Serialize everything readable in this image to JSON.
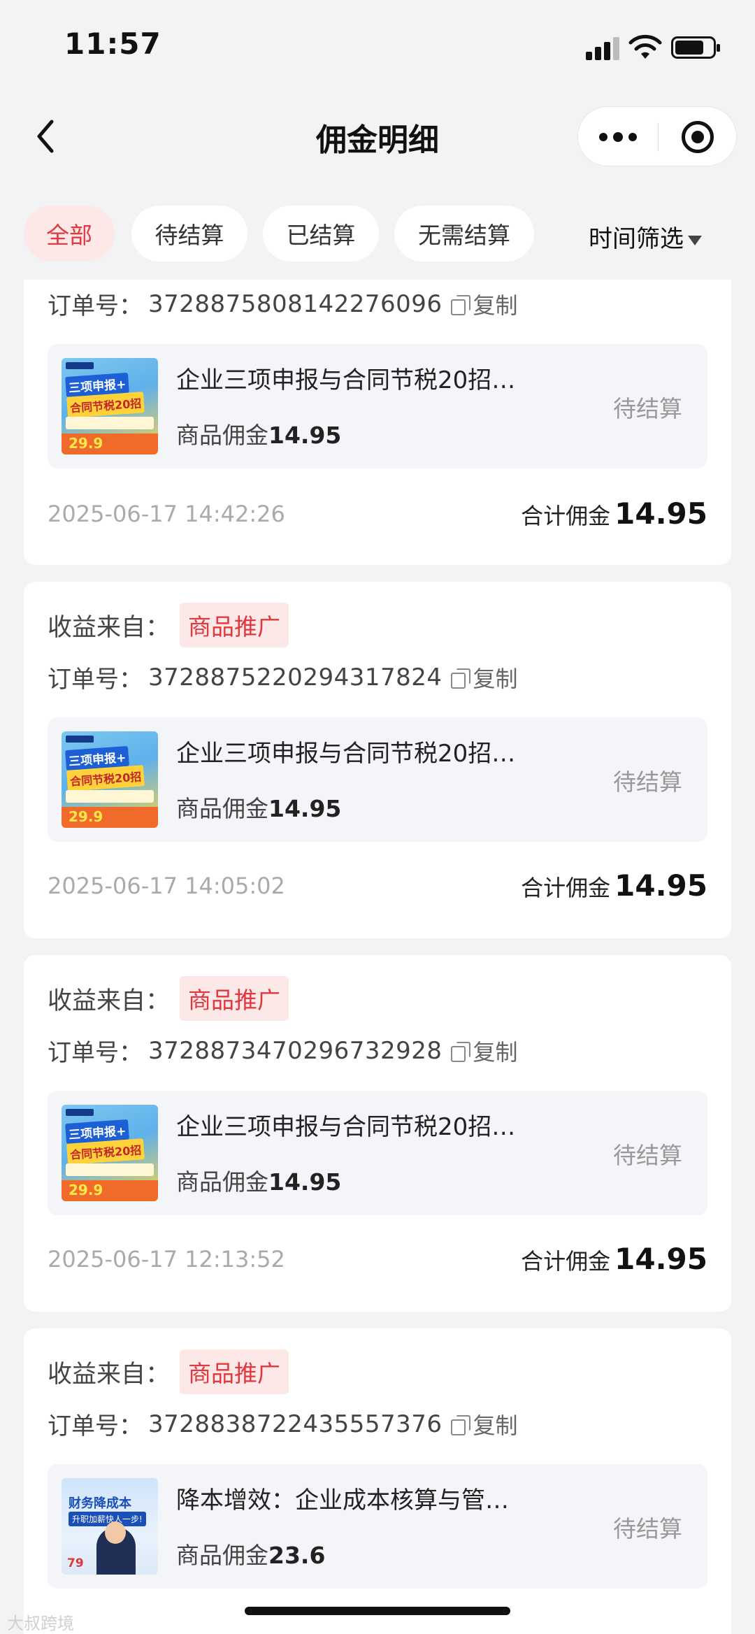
{
  "status_bar": {
    "time": "11:57"
  },
  "nav": {
    "title": "佣金明细"
  },
  "tabs": [
    {
      "label": "全部"
    },
    {
      "label": "待结算"
    },
    {
      "label": "已结算"
    },
    {
      "label": "无需结算"
    }
  ],
  "time_filter": {
    "label": "时间筛选"
  },
  "labels": {
    "source_prefix": "收益来自：",
    "order_prefix": "订单号：",
    "copy": "复制",
    "commission_prefix": "商品佣金",
    "total_prefix": "合计佣金"
  },
  "orders": [
    {
      "order_no": "3728875808142276096",
      "product_title": "企业三项申报与合同节税20招…",
      "commission": "14.95",
      "status": "待结算",
      "timestamp": "2025-06-17 14:42:26",
      "total": "14.95"
    },
    {
      "source": "商品推广",
      "order_no": "3728875220294317824",
      "product_title": "企业三项申报与合同节税20招…",
      "commission": "14.95",
      "status": "待结算",
      "timestamp": "2025-06-17 14:05:02",
      "total": "14.95"
    },
    {
      "source": "商品推广",
      "order_no": "3728873470296732928",
      "product_title": "企业三项申报与合同节税20招…",
      "commission": "14.95",
      "status": "待结算",
      "timestamp": "2025-06-17 12:13:52",
      "total": "14.95"
    },
    {
      "source": "商品推广",
      "order_no": "3728838722435557376",
      "product_title": "降本增效：企业成本核算与管…",
      "commission": "23.6",
      "status": "待结算"
    }
  ],
  "thumb_a": {
    "line1": "三项申报+",
    "line2": "合同节税20招",
    "price": "29.9"
  },
  "thumb_b": {
    "line1": "财务降成本",
    "line2": "升职加薪快人一步!",
    "price": "79"
  },
  "watermark": "大叔跨境"
}
